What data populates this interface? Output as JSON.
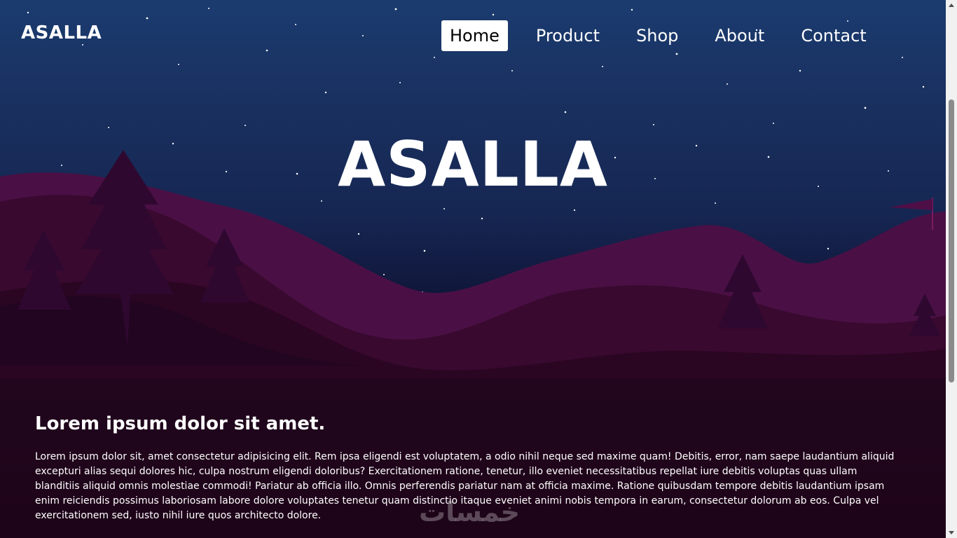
{
  "header": {
    "logo": "ASALLA",
    "nav": [
      {
        "label": "Home",
        "active": true
      },
      {
        "label": "Product",
        "active": false
      },
      {
        "label": "Shop",
        "active": false
      },
      {
        "label": "About",
        "active": false
      },
      {
        "label": "Contact",
        "active": false
      }
    ]
  },
  "hero": {
    "title": "ASALLA"
  },
  "content": {
    "heading": "Lorem ipsum dolor sit amet.",
    "paragraph": "Lorem ipsum dolor sit, amet consectetur adipisicing elit. Rem ipsa eligendi est voluptatem, a odio nihil neque sed maxime quam! Debitis, error, nam saepe laudantium aliquid excepturi alias sequi dolores hic, culpa nostrum eligendi doloribus? Exercitationem ratione, tenetur, illo eveniet necessitatibus repellat iure debitis voluptas quas ullam blanditiis aliquid omnis molestiae commodi! Pariatur ab officia illo. Omnis perferendis pariatur nam at officia maxime. Ratione quibusdam tempore debitis laudantium ipsam enim reiciendis possimus laboriosam labore dolore voluptates tenetur quam distinctio itaque eveniet animi nobis tempora in earum, consectetur dolorum ab eos. Culpa vel exercitationem sed, iusto nihil iure quos architecto dolore."
  },
  "watermark": "خمسات",
  "colors": {
    "sky_top": "#1b3b6f",
    "sky_bottom": "#10163a",
    "hills": "#4a1045",
    "ground": "#1e0418",
    "text": "#ffffff",
    "active_nav_bg": "#ffffff"
  }
}
